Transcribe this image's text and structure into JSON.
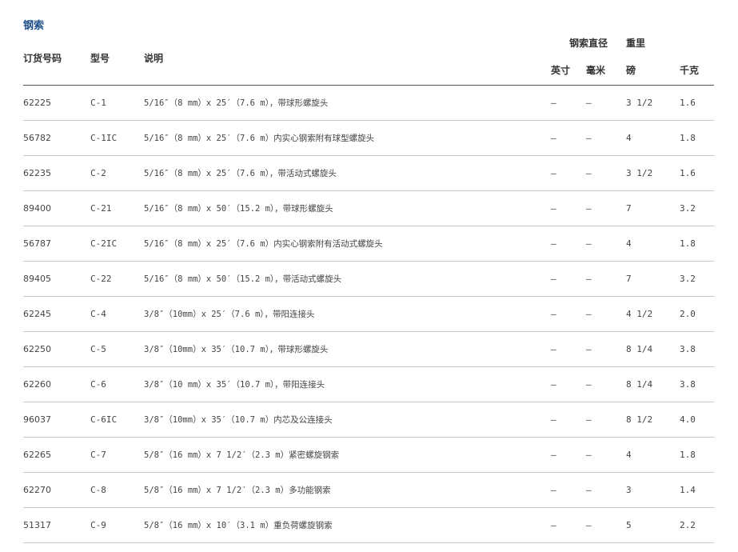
{
  "section_title": "钢索",
  "header": {
    "order_no": "订货号码",
    "model": "型号",
    "description": "说明",
    "diameter_group": "钢索直径",
    "weight_group": "重里",
    "inch": "英寸",
    "mm": "毫米",
    "lb": "磅",
    "kg": "千克"
  },
  "rows": [
    {
      "order": "62225",
      "model": "C-1",
      "desc": "5/16″（8 mm）x 25′（7.6 m），带球形螺旋头",
      "inch": "—",
      "mm": "—",
      "lb": "3 1/2",
      "kg": "1.6"
    },
    {
      "order": "56782",
      "model": "C-1IC",
      "desc": "5/16″（8 mm）x 25′（7.6 m）内实心钢索附有球型螺旋头",
      "inch": "—",
      "mm": "—",
      "lb": "4",
      "kg": "1.8"
    },
    {
      "order": "62235",
      "model": "C-2",
      "desc": "5/16″（8 mm）x 25′（7.6 m），带活动式螺旋头",
      "inch": "—",
      "mm": "—",
      "lb": "3 1/2",
      "kg": "1.6"
    },
    {
      "order": "89400",
      "model": "C-21",
      "desc": "5/16″（8 mm）x 50′（15.2 m），带球形螺旋头",
      "inch": "—",
      "mm": "—",
      "lb": "7",
      "kg": "3.2"
    },
    {
      "order": "56787",
      "model": "C-2IC",
      "desc": "5/16″（8 mm）x 25′（7.6 m）内实心钢索附有活动式螺旋头",
      "inch": "—",
      "mm": "—",
      "lb": "4",
      "kg": "1.8"
    },
    {
      "order": "89405",
      "model": "C-22",
      "desc": "5/16″（8 mm）x 50′（15.2 m），带活动式螺旋头",
      "inch": "—",
      "mm": "—",
      "lb": "7",
      "kg": "3.2"
    },
    {
      "order": "62245",
      "model": "C-4",
      "desc": "3/8″（10mm）x 25′（7.6 m），带阳连接头",
      "inch": "—",
      "mm": "—",
      "lb": "4 1/2",
      "kg": "2.0"
    },
    {
      "order": "62250",
      "model": "C-5",
      "desc": "3/8″（10mm）x 35′（10.7 m），带球形螺旋头",
      "inch": "—",
      "mm": "—",
      "lb": "8 1/4",
      "kg": "3.8"
    },
    {
      "order": "62260",
      "model": "C-6",
      "desc": "3/8″（10 mm）x 35′（10.7 m），带阳连接头",
      "inch": "—",
      "mm": "—",
      "lb": "8 1/4",
      "kg": "3.8"
    },
    {
      "order": "96037",
      "model": "C-6IC",
      "desc": "3/8″（10mm）x 35′（10.7 m）内芯及公连接头",
      "inch": "—",
      "mm": "—",
      "lb": "8 1/2",
      "kg": "4.0"
    },
    {
      "order": "62265",
      "model": "C-7",
      "desc": "5/8″（16 mm）x 7 1/2′（2.3 m）紧密螺旋钢索",
      "inch": "—",
      "mm": "—",
      "lb": "4",
      "kg": "1.8"
    },
    {
      "order": "62270",
      "model": "C-8",
      "desc": "5/8″（16 mm）x 7 1/2′（2.3 m）多功能钢索",
      "inch": "—",
      "mm": "—",
      "lb": "3",
      "kg": "1.4"
    },
    {
      "order": "51317",
      "model": "C-9",
      "desc": "5/8″（16 mm）x 10′（3.1 m）重负荷螺旋钢索",
      "inch": "—",
      "mm": "—",
      "lb": "5",
      "kg": "2.2"
    }
  ]
}
